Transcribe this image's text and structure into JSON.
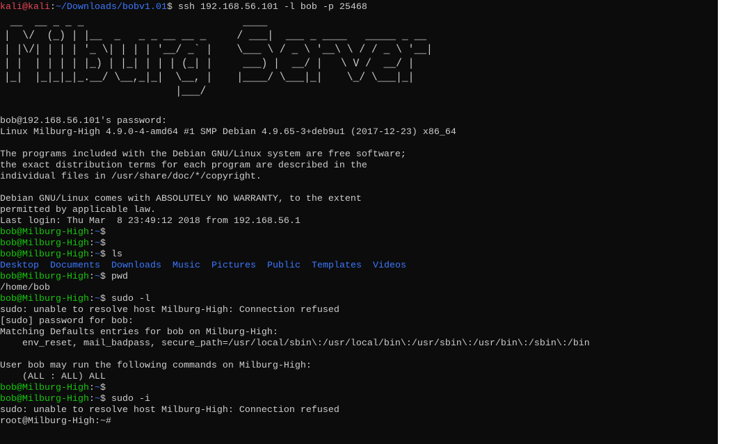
{
  "colors": {
    "background": "#0c0c0c",
    "text": "#cccccc",
    "kali_prompt": "#e74856",
    "path": "#3b78ff",
    "bob_prompt": "#16c60c",
    "directory": "#3b78ff"
  },
  "kali_prompt": {
    "user": "kali@kali",
    "sep": ":",
    "path": "~/Downloads/bobv1.01",
    "end": "$ ",
    "command": "ssh 192.168.56.101 -l bob -p 25468"
  },
  "banner": " __  __ _ _ _                          ____                            \n|  \\/  (_) | |__  _   _ _ __ __ _     / ___|  ___ _ ____   _____ _ __ \n| |\\/| | | | '_ \\| | | | '__/ _` |    \\___ \\ / _ \\ '__\\ \\ / / _ \\ '__|\n| |  | | | | |_) | |_| | | | (_| |     ___) |  __/ |   \\ V /  __/ |   \n|_|  |_|_|_|_.__/ \\__,_|_|  \\__, |    |____/ \\___|_|    \\_/ \\___|_|   \n                            |___/                                      ",
  "lines": {
    "password": "bob@192.168.56.101's password:",
    "uname": "Linux Milburg-High 4.9.0-4-amd64 #1 SMP Debian 4.9.65-3+deb9u1 (2017-12-23) x86_64",
    "motd1": "The programs included with the Debian GNU/Linux system are free software;",
    "motd2": "the exact distribution terms for each program are described in the",
    "motd3": "individual files in /usr/share/doc/*/copyright.",
    "motd4": "Debian GNU/Linux comes with ABSOLUTELY NO WARRANTY, to the extent",
    "motd5": "permitted by applicable law.",
    "lastlogin": "Last login: Thu Mar  8 23:49:12 2018 from 192.168.56.1",
    "home": "/home/bob",
    "sudo_err1": "sudo: unable to resolve host Milburg-High: Connection refused",
    "sudo_pw": "[sudo] password for bob:",
    "defaults": "Matching Defaults entries for bob on Milburg-High:",
    "env": "    env_reset, mail_badpass, secure_path=/usr/local/sbin\\:/usr/local/bin\\:/usr/sbin\\:/usr/bin\\:/sbin\\:/bin",
    "may_run": "User bob may run the following commands on Milburg-High:",
    "all": "    (ALL : ALL) ALL",
    "sudo_err2": "sudo: unable to resolve host Milburg-High: Connection refused"
  },
  "bob_prompt": {
    "user": "bob@Milburg-High",
    "sep": ":",
    "path": "~",
    "end": "$ "
  },
  "root_prompt": "root@Milburg-High:~# ",
  "commands": {
    "c1": "",
    "c2": "",
    "c3": "ls",
    "c4": "pwd",
    "c5": "sudo -l",
    "c6": "",
    "c7": "sudo -i"
  },
  "ls_output": [
    "Desktop",
    "Documents",
    "Downloads",
    "Music",
    "Pictures",
    "Public",
    "Templates",
    "Videos"
  ]
}
